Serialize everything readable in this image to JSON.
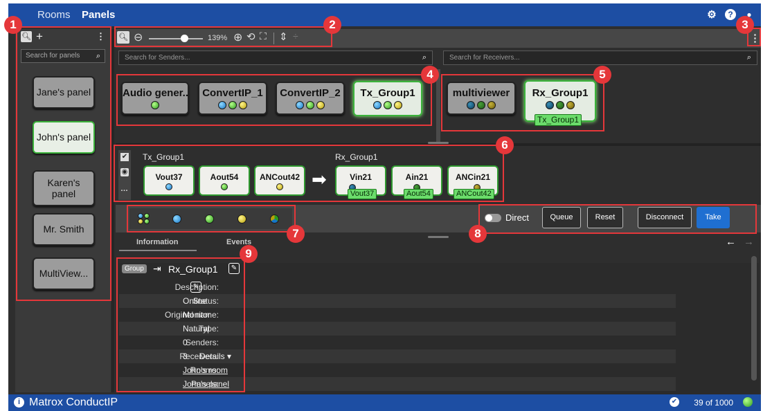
{
  "topbar": {
    "rooms": "Rooms",
    "panels": "Panels"
  },
  "left": {
    "search_placeholder": "Search for panels",
    "panels": [
      "Jane's panel",
      "John's panel",
      "Karen's panel",
      "Mr. Smith",
      "MultiView..."
    ]
  },
  "toolbar": {
    "zoom": "139%"
  },
  "senders": {
    "search_placeholder": "Search for Senders...",
    "devices": [
      {
        "name": "Audio gener...",
        "dots": [
          "green"
        ]
      },
      {
        "name": "ConvertIP_1",
        "dots": [
          "blue",
          "green",
          "yellow"
        ]
      },
      {
        "name": "ConvertIP_2",
        "dots": [
          "blue",
          "green",
          "yellow"
        ]
      },
      {
        "name": "Tx_Group1",
        "dots": [
          "blue",
          "green",
          "yellow"
        ],
        "selected": true
      }
    ]
  },
  "receivers": {
    "search_placeholder": "Search for Receivers...",
    "devices": [
      {
        "name": "multiviewer",
        "dots": [
          "blue-dark",
          "green-dark",
          "yellow-dark"
        ]
      },
      {
        "name": "Rx_Group1",
        "dots": [
          "blue-dark",
          "green-dark",
          "yellow-dark"
        ],
        "selected": true,
        "tag": "Tx_Group1"
      }
    ]
  },
  "routing": {
    "tx_title": "Tx_Group1",
    "rx_title": "Rx_Group1",
    "tx": [
      {
        "name": "Vout37",
        "dot": "blue"
      },
      {
        "name": "Aout54",
        "dot": "green"
      },
      {
        "name": "ANCout42",
        "dot": "yellow"
      }
    ],
    "rx": [
      {
        "name": "Vin21",
        "tag": "Vout37"
      },
      {
        "name": "Ain21",
        "tag": "Aout54"
      },
      {
        "name": "ANCin21",
        "tag": "ANCout42"
      }
    ]
  },
  "actions": {
    "direct": "Direct",
    "queue": "Queue",
    "reset": "Reset",
    "disconnect": "Disconnect",
    "take": "Take"
  },
  "tabs": {
    "information": "Information",
    "events": "Events"
  },
  "info": {
    "badge": "Group",
    "title": "Rx_Group1",
    "rows": [
      {
        "k": "Description:",
        "v": ""
      },
      {
        "k": "Status:",
        "v": "Online"
      },
      {
        "k": "Original name:",
        "v": "Monitor"
      },
      {
        "k": "Type:",
        "v": "Natural"
      },
      {
        "k": "Senders:",
        "v": "0"
      },
      {
        "k": "Receivers:",
        "v": "3"
      },
      {
        "k": "Rooms:",
        "v": "John's room"
      },
      {
        "k": "Panels:",
        "v": "John's panel"
      }
    ],
    "details": "Details"
  },
  "status": {
    "brand": "Matrox ConductIP",
    "count": "39 of 1000"
  },
  "callouts": [
    "1",
    "2",
    "3",
    "4",
    "5",
    "6",
    "7",
    "8",
    "9"
  ],
  "colors": {
    "accent": "#1d4ea3",
    "callout": "#e5373a",
    "selected": "#3bb23b"
  }
}
